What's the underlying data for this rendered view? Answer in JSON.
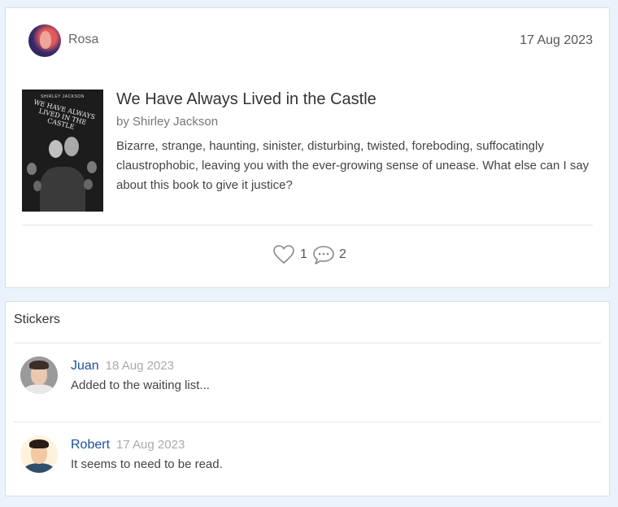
{
  "post": {
    "poster_name": "Rosa",
    "date": "17 Aug 2023",
    "book": {
      "title": "We Have Always Lived in the Castle",
      "author": "by Shirley Jackson",
      "cover_author": "SHIRLEY JACKSON",
      "cover_title": "WE HAVE ALWAYS LIVED IN THE CASTLE"
    },
    "review": "Bizarre, strange, haunting, sinister, disturbing, twisted, foreboding, suffocatingly claustrophobic, leaving you with the ever-growing sense of unease. What else can I say about this book to give it justice?",
    "likes": "1",
    "comments": "2"
  },
  "stickers": {
    "header": "Stickers",
    "items": [
      {
        "name": "Juan",
        "date": "18 Aug 2023",
        "text": "Added to the waiting list..."
      },
      {
        "name": "Robert",
        "date": "17 Aug 2023",
        "text": "It seems to need to be read."
      }
    ]
  },
  "colors": {
    "background": "#eaf3fc",
    "name_link": "#1f4e9a",
    "icon_gray": "#888888"
  },
  "icons": [
    "heart-icon",
    "comment-icon"
  ]
}
